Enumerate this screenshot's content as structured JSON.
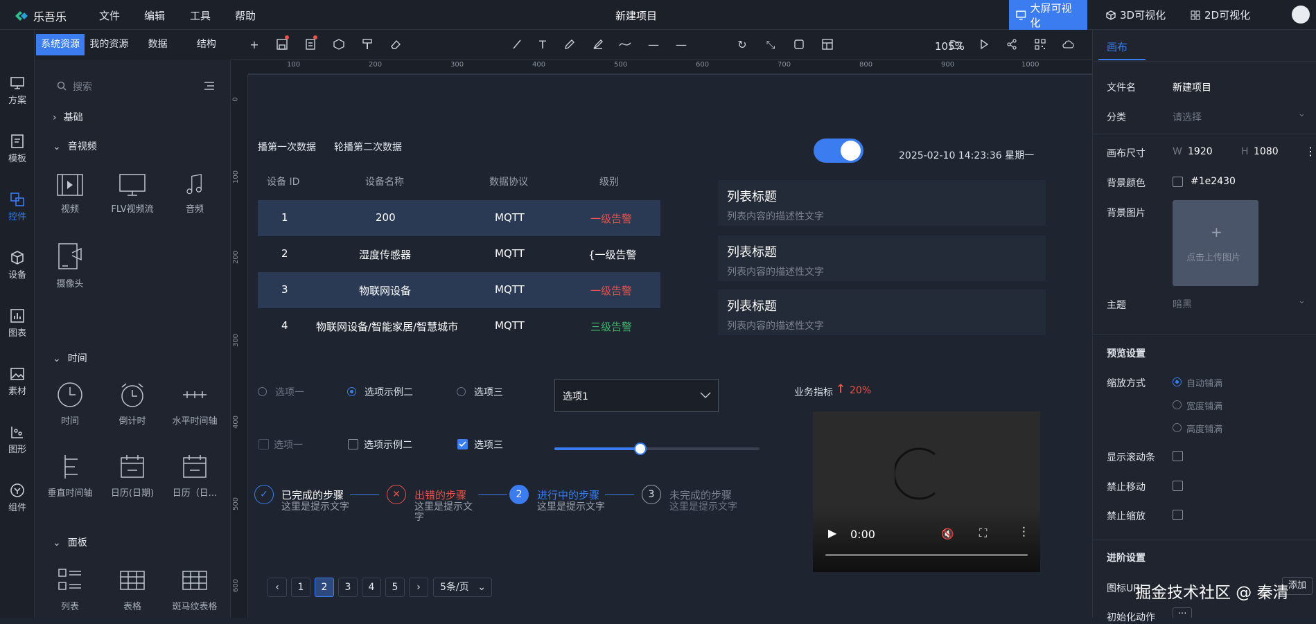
{
  "app": {
    "logo": "乐吾乐",
    "project_title": "新建项目",
    "accent": "#3b7df0"
  },
  "menu": [
    "文件",
    "编辑",
    "工具",
    "帮助"
  ],
  "top_tabs": [
    "大屏可视化",
    "3D可视化",
    "2D可视化"
  ],
  "left_nav": [
    "方案",
    "模板",
    "控件",
    "设备",
    "图表",
    "素材",
    "图形",
    "组件"
  ],
  "panel_tabs": [
    "系统资源",
    "我的资源",
    "数据",
    "结构"
  ],
  "search_placeholder": "搜索",
  "sections": {
    "basic": "基础",
    "av": "音视频",
    "av_items": [
      "视频",
      "FLV视频流",
      "音频",
      "摄像头"
    ],
    "time": "时间",
    "time_items": [
      "时间",
      "倒计时",
      "水平时间轴",
      "垂直时间轴",
      "日历(日期)",
      "日历（日..."
    ],
    "panel": "面板",
    "panel_items": [
      "列表",
      "表格",
      "斑马纹表格"
    ]
  },
  "toolbar": {
    "zoom": "105%"
  },
  "ruler_h": [
    "100",
    "200",
    "300",
    "400",
    "500",
    "600",
    "700",
    "800",
    "900",
    "1000"
  ],
  "ruler_v": [
    "0",
    "100",
    "200",
    "300",
    "400",
    "500",
    "600"
  ],
  "canvas": {
    "carousel_labels": [
      "播第一次数据",
      "轮播第二次数据"
    ],
    "table_headers": [
      "设备 ID",
      "设备名称",
      "数据协议",
      "级别"
    ],
    "table_rows": [
      {
        "id": "1",
        "name": "200",
        "proto": "MQTT",
        "level": "一级告警",
        "color": "#e8534a"
      },
      {
        "id": "2",
        "name": "湿度传感器",
        "proto": "MQTT",
        "level": "{一级告警",
        "color": "#ffffff"
      },
      {
        "id": "3",
        "name": "物联网设备",
        "proto": "MQTT",
        "level": "一级告警",
        "color": "#e8534a"
      },
      {
        "id": "4",
        "name": "物联网设备/智能家居/智慧城市",
        "proto": "MQTT",
        "level": "三级告警",
        "color": "#3fb86b"
      }
    ],
    "datetime": "2025-02-10 14:23:36 星期一",
    "list_items": [
      {
        "title": "列表标题",
        "desc": "列表内容的描述性文字"
      },
      {
        "title": "列表标题",
        "desc": "列表内容的描述性文字"
      },
      {
        "title": "列表标题",
        "desc": "列表内容的描述性文字"
      }
    ],
    "radios": [
      "选项一",
      "选项示例二",
      "选项三"
    ],
    "checkboxes": [
      "选项一",
      "选项示例二",
      "选项三"
    ],
    "select_value": "选项1",
    "slider_value": 0.42,
    "biz_label": "业务指标",
    "biz_value": "20%",
    "steps": [
      {
        "title": "已完成的步骤",
        "desc": "这里是提示文字",
        "state": "done"
      },
      {
        "title": "出错的步骤",
        "desc": "这里是提示文字",
        "state": "error"
      },
      {
        "title": "进行中的步骤",
        "desc": "这里是提示文字",
        "state": "active",
        "num": "2"
      },
      {
        "title": "未完成的步骤",
        "desc": "这里是提示文字",
        "state": "todo",
        "num": "3"
      }
    ],
    "pagination": {
      "pages": [
        "1",
        "2",
        "3",
        "4",
        "5"
      ],
      "current": "2",
      "size": "5条/页"
    },
    "video_time": "0:00"
  },
  "right": {
    "tab": "画布",
    "file_name_label": "文件名",
    "file_name": "新建项目",
    "category_label": "分类",
    "category_ph": "请选择",
    "size_label": "画布尺寸",
    "w_label": "W",
    "w": "1920",
    "h_label": "H",
    "h": "1080",
    "bgcolor_label": "背景颜色",
    "bgcolor": "#1e2430",
    "bgimg_label": "背景图片",
    "upload": "点击上传图片",
    "theme_label": "主题",
    "theme": "暗黑",
    "preview_title": "预览设置",
    "scale_label": "缩放方式",
    "scale_opts": [
      "自动铺满",
      "宽度铺满",
      "高度铺满"
    ],
    "scrollbar_label": "显示滚动条",
    "nomove_label": "禁止移动",
    "nozoom_label": "禁止缩放",
    "advanced_title": "进阶设置",
    "icon_url_label": "图标URL",
    "add_btn": "添加",
    "init_label": "初始化动作"
  },
  "watermark": "掘金技术社区 @ 秦清"
}
